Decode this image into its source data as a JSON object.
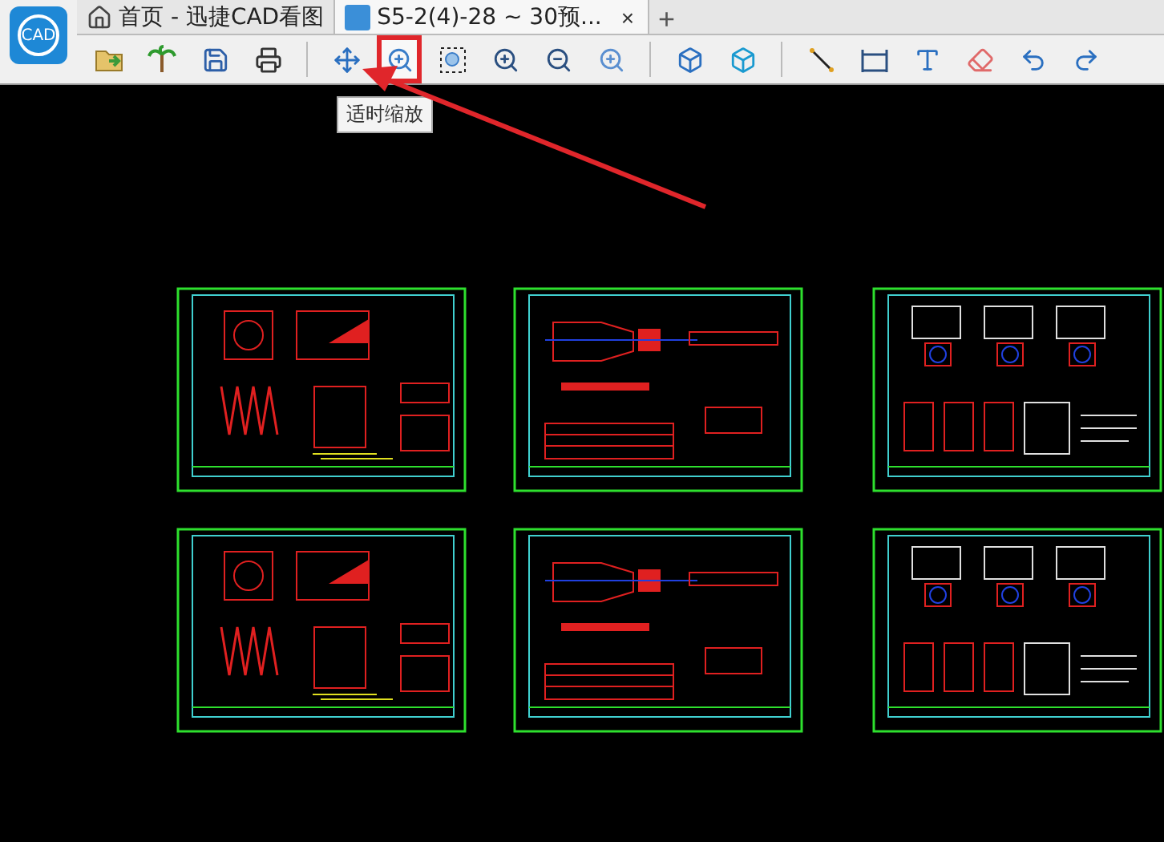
{
  "logo": "CAD",
  "tabs": [
    {
      "label": "首页 - 迅捷CAD看图",
      "kind": "home",
      "selected": false
    },
    {
      "label": "S5-2(4)-28 ~ 30预...",
      "kind": "drawing",
      "selected": true,
      "close": "×"
    }
  ],
  "new_tab": "+",
  "toolbar": [
    {
      "kind": "open",
      "highlighted": false
    },
    {
      "kind": "palm",
      "highlighted": false
    },
    {
      "kind": "save",
      "highlighted": false
    },
    {
      "kind": "print",
      "highlighted": false
    },
    {
      "kind": "sep"
    },
    {
      "kind": "pan",
      "highlighted": false
    },
    {
      "kind": "fit",
      "highlighted": true
    },
    {
      "kind": "window",
      "highlighted": false
    },
    {
      "kind": "zoomin",
      "highlighted": false
    },
    {
      "kind": "zoomout",
      "highlighted": false
    },
    {
      "kind": "zoomprev",
      "highlighted": false
    },
    {
      "kind": "sep"
    },
    {
      "kind": "cube",
      "highlighted": false
    },
    {
      "kind": "cube3d",
      "highlighted": false
    },
    {
      "kind": "sep"
    },
    {
      "kind": "line",
      "highlighted": false
    },
    {
      "kind": "dim",
      "highlighted": false
    },
    {
      "kind": "text",
      "highlighted": false
    },
    {
      "kind": "eraser",
      "highlighted": false
    },
    {
      "kind": "undo",
      "highlighted": false
    },
    {
      "kind": "redo",
      "highlighted": false
    }
  ],
  "tooltip": "适时缩放"
}
